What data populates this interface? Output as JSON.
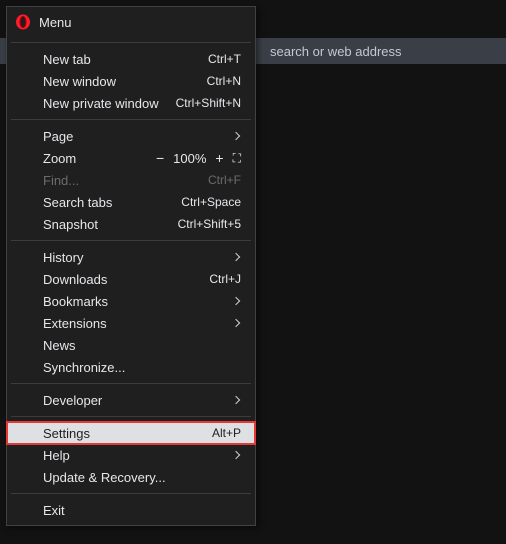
{
  "address_bar": {
    "placeholder_fragment": "search or web address"
  },
  "menu": {
    "title": "Menu",
    "items": {
      "new_tab": {
        "label": "New tab",
        "shortcut": "Ctrl+T"
      },
      "new_window": {
        "label": "New window",
        "shortcut": "Ctrl+N"
      },
      "new_private": {
        "label": "New private window",
        "shortcut": "Ctrl+Shift+N"
      },
      "page": {
        "label": "Page"
      },
      "zoom": {
        "label": "Zoom",
        "value": "100%"
      },
      "find": {
        "label": "Find...",
        "shortcut": "Ctrl+F"
      },
      "search_tabs": {
        "label": "Search tabs",
        "shortcut": "Ctrl+Space"
      },
      "snapshot": {
        "label": "Snapshot",
        "shortcut": "Ctrl+Shift+5"
      },
      "history": {
        "label": "History"
      },
      "downloads": {
        "label": "Downloads",
        "shortcut": "Ctrl+J"
      },
      "bookmarks": {
        "label": "Bookmarks"
      },
      "extensions": {
        "label": "Extensions"
      },
      "news": {
        "label": "News"
      },
      "synchronize": {
        "label": "Synchronize..."
      },
      "developer": {
        "label": "Developer"
      },
      "settings": {
        "label": "Settings",
        "shortcut": "Alt+P"
      },
      "help": {
        "label": "Help"
      },
      "update": {
        "label": "Update & Recovery..."
      },
      "exit": {
        "label": "Exit"
      }
    }
  }
}
